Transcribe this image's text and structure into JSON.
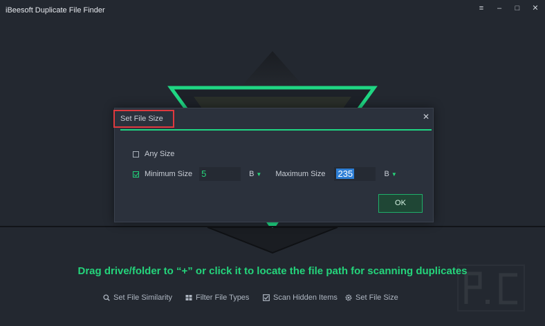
{
  "app": {
    "title": "iBeesoft Duplicate File Finder"
  },
  "window_controls": [
    "menu-icon",
    "minimize-icon",
    "maximize-icon",
    "close-icon"
  ],
  "dialog": {
    "title": "Set File Size",
    "any_size_label": "Any Size",
    "any_size_checked": false,
    "min_checked": true,
    "min_label": "Minimum Size",
    "min_value": "5",
    "min_unit": "B",
    "max_label": "Maximum Size",
    "max_value": "235",
    "max_unit": "B",
    "ok_label": "OK"
  },
  "prompt": "Drag drive/folder to “+” or click it to locate the file path for scanning duplicates",
  "toolbar": {
    "similarity": "Set File Similarity",
    "filter": "Filter File Types",
    "hidden": "Scan Hidden Items",
    "size": "Set File Size"
  },
  "colors": {
    "accent": "#21d27a",
    "background": "#232830",
    "dialog": "#2b313c",
    "highlight_box": "#e0393e"
  }
}
